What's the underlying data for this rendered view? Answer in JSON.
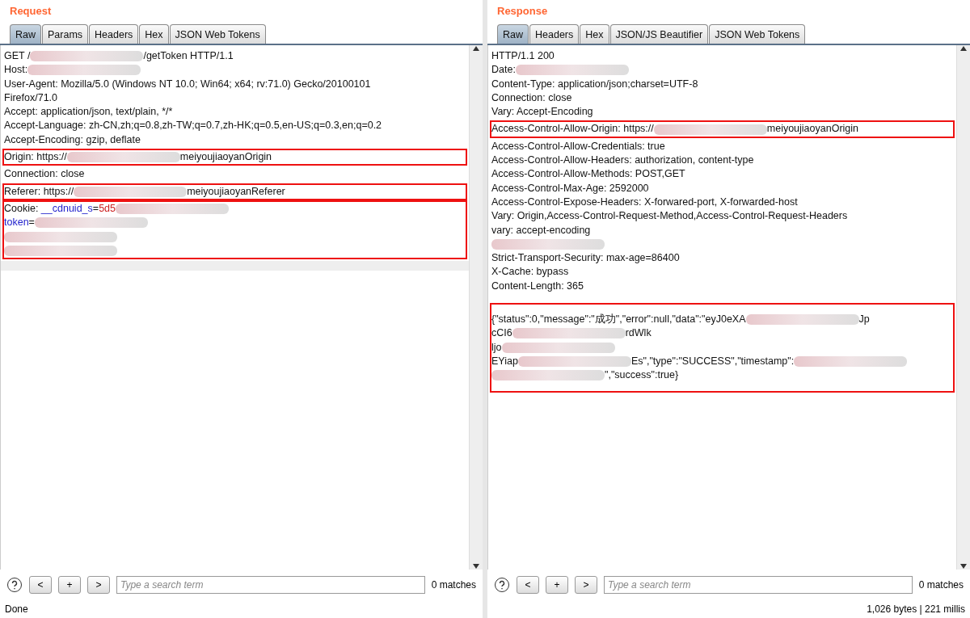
{
  "panels": [
    {
      "title": "Request",
      "tabs": [
        {
          "label": "Raw",
          "selected": true
        },
        {
          "label": "Params",
          "selected": false
        },
        {
          "label": "Headers",
          "selected": false
        },
        {
          "label": "Hex",
          "selected": false
        },
        {
          "label": "JSON Web Tokens",
          "selected": false
        }
      ],
      "blocks": [
        {
          "highlighted": false,
          "lines": [
            [
              {
                "kind": "text",
                "text": "GET /"
              },
              {
                "kind": "redacted"
              },
              {
                "kind": "text",
                "text": "/getToken HTTP/1.1"
              }
            ],
            [
              {
                "kind": "text",
                "text": "Host:"
              },
              {
                "kind": "redacted"
              }
            ],
            [
              {
                "kind": "text",
                "text": "User-Agent: Mozilla/5.0 (Windows NT 10.0; Win64; x64; rv:71.0) Gecko/20100101"
              }
            ],
            [
              {
                "kind": "text",
                "text": "Firefox/71.0"
              }
            ],
            [
              {
                "kind": "text",
                "text": "Accept: application/json, text/plain, */*"
              }
            ],
            [
              {
                "kind": "text",
                "text": "Accept-Language: zh-CN,zh;q=0.8,zh-TW;q=0.7,zh-HK;q=0.5,en-US;q=0.3,en;q=0.2"
              }
            ],
            [
              {
                "kind": "text",
                "text": "Accept-Encoding: gzip, deflate"
              }
            ]
          ]
        },
        {
          "highlighted": true,
          "lines": [
            [
              {
                "kind": "text",
                "text": "Origin: https://"
              },
              {
                "kind": "redacted"
              },
              {
                "kind": "text",
                "text": "meiyoujiaoyanOrigin"
              }
            ]
          ]
        },
        {
          "highlighted": false,
          "lines": [
            [
              {
                "kind": "text",
                "text": "Connection: close"
              }
            ]
          ]
        },
        {
          "highlighted": true,
          "lines": [
            [
              {
                "kind": "text",
                "text": "Referer: https://"
              },
              {
                "kind": "redacted"
              },
              {
                "kind": "text",
                "text": "meiyoujiaoyanReferer"
              }
            ]
          ]
        },
        {
          "highlighted": true,
          "lines": [
            [
              {
                "kind": "text",
                "text": "Cookie: "
              },
              {
                "kind": "key",
                "text": "__cdnuid_s"
              },
              {
                "kind": "text",
                "text": "="
              },
              {
                "kind": "value",
                "text": "5d5"
              },
              {
                "kind": "redacted"
              }
            ],
            [
              {
                "kind": "key",
                "text": "token"
              },
              {
                "kind": "text",
                "text": "="
              },
              {
                "kind": "redacted"
              }
            ],
            [
              {
                "kind": "redacted"
              }
            ],
            [
              {
                "kind": "redacted"
              }
            ]
          ]
        }
      ],
      "search": {
        "placeholder": "Type a search term"
      },
      "matches": "0 matches",
      "status": "Done"
    },
    {
      "title": "Response",
      "tabs": [
        {
          "label": "Raw",
          "selected": true
        },
        {
          "label": "Headers",
          "selected": false
        },
        {
          "label": "Hex",
          "selected": false
        },
        {
          "label": "JSON/JS Beautifier",
          "selected": false
        },
        {
          "label": "JSON Web Tokens",
          "selected": false
        }
      ],
      "blocks": [
        {
          "highlighted": false,
          "lines": [
            [
              {
                "kind": "text",
                "text": "HTTP/1.1 200"
              }
            ],
            [
              {
                "kind": "text",
                "text": "Date:"
              },
              {
                "kind": "redacted"
              }
            ],
            [
              {
                "kind": "text",
                "text": "Content-Type: application/json;charset=UTF-8"
              }
            ],
            [
              {
                "kind": "text",
                "text": "Connection: close"
              }
            ],
            [
              {
                "kind": "text",
                "text": "Vary: Accept-Encoding"
              }
            ]
          ]
        },
        {
          "highlighted": true,
          "lines": [
            [
              {
                "kind": "text",
                "text": "Access-Control-Allow-Origin: https://"
              },
              {
                "kind": "redacted"
              },
              {
                "kind": "text",
                "text": "meiyoujiaoyanOrigin"
              }
            ]
          ]
        },
        {
          "highlighted": false,
          "lines": [
            [
              {
                "kind": "text",
                "text": "Access-Control-Allow-Credentials: true"
              }
            ],
            [
              {
                "kind": "text",
                "text": "Access-Control-Allow-Headers: authorization, content-type"
              }
            ],
            [
              {
                "kind": "text",
                "text": "Access-Control-Allow-Methods: POST,GET"
              }
            ],
            [
              {
                "kind": "text",
                "text": "Access-Control-Max-Age: 2592000"
              }
            ],
            [
              {
                "kind": "text",
                "text": "Access-Control-Expose-Headers: X-forwared-port, X-forwarded-host"
              }
            ],
            [
              {
                "kind": "text",
                "text": "Vary: Origin,Access-Control-Request-Method,Access-Control-Request-Headers"
              }
            ],
            [
              {
                "kind": "text",
                "text": "vary: accept-encoding"
              }
            ],
            [
              {
                "kind": "redacted"
              }
            ],
            [
              {
                "kind": "text",
                "text": "Strict-Transport-Security: max-age=86400"
              }
            ],
            [
              {
                "kind": "text",
                "text": "X-Cache: bypass"
              }
            ],
            [
              {
                "kind": "text",
                "text": "Content-Length: 365"
              }
            ]
          ]
        },
        {
          "highlighted": true,
          "kind": "body",
          "lines": [
            [
              {
                "kind": "text",
                "text": "{\"status\":0,\"message\":\"成功\",\"error\":null,\"data\":\"eyJ0eXA"
              },
              {
                "kind": "redacted"
              },
              {
                "kind": "text",
                "text": "Jp"
              }
            ],
            [
              {
                "kind": "text",
                "text": "cCI6"
              },
              {
                "kind": "redacted"
              },
              {
                "kind": "text",
                "text": "rdWlk"
              }
            ],
            [
              {
                "kind": "text",
                "text": "ljo"
              },
              {
                "kind": "redacted"
              }
            ],
            [
              {
                "kind": "text",
                "text": "EYiap"
              },
              {
                "kind": "redacted"
              },
              {
                "kind": "text",
                "text": "Es\",\"type\":\"SUCCESS\",\"timestamp\":"
              },
              {
                "kind": "redacted"
              }
            ],
            [
              {
                "kind": "redacted"
              },
              {
                "kind": "text",
                "text": "\",\"success\":true}"
              }
            ]
          ]
        }
      ],
      "search": {
        "placeholder": "Type a search term"
      },
      "matches": "0 matches",
      "status": "1,026 bytes | 221 millis"
    }
  ],
  "nav_buttons": [
    "<",
    "+",
    ">"
  ]
}
